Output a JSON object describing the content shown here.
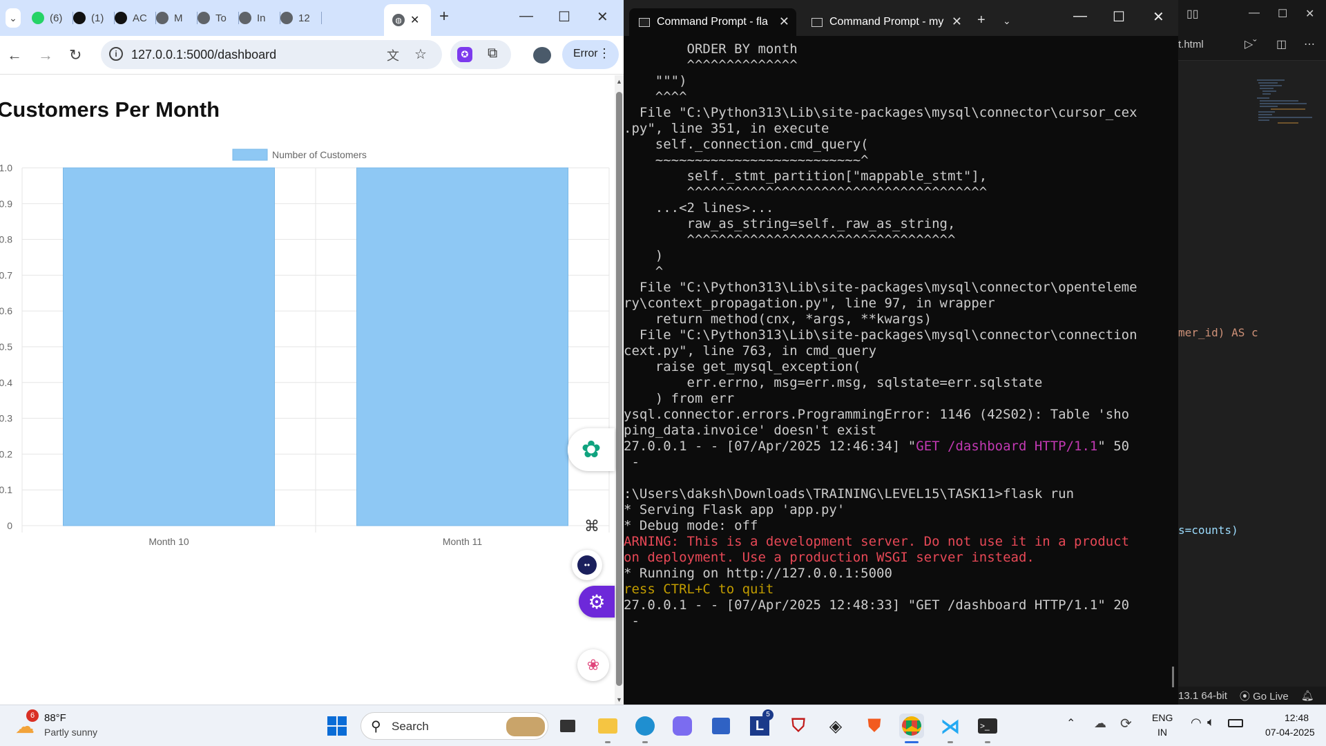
{
  "chrome": {
    "tabs": [
      {
        "label": "(6)",
        "icon": "whatsapp-icon",
        "color": "#25d366"
      },
      {
        "label": "(1)",
        "icon": "notion-icon",
        "color": "#111111"
      },
      {
        "label": "AC",
        "icon": "openai-icon",
        "color": "#111111"
      },
      {
        "label": "M",
        "icon": "globe-icon",
        "color": "#5f6368"
      },
      {
        "label": "To",
        "icon": "globe-icon",
        "color": "#5f6368"
      },
      {
        "label": "In",
        "icon": "globe-icon",
        "color": "#5f6368"
      },
      {
        "label": "12",
        "icon": "globe-icon",
        "color": "#5f6368"
      }
    ],
    "active_tab_close": "✕",
    "new_tab": "+",
    "url": "127.0.0.1:5000/dashboard",
    "error_label": "Error",
    "page_title": "Customers Per Month"
  },
  "chart_data": {
    "type": "bar",
    "title": "Customers Per Month",
    "categories": [
      "Month 10",
      "Month 11"
    ],
    "series": [
      {
        "name": "Number of Customers",
        "values": [
          1,
          1
        ]
      }
    ],
    "ylim": [
      0,
      1
    ],
    "y_ticks": [
      "0",
      "0.1",
      "0.2",
      "0.3",
      "0.4",
      "0.5",
      "0.6",
      "0.7",
      "0.8",
      "0.9",
      "1.0"
    ],
    "grid": true,
    "legend": "top-center",
    "bar_color": "#8ec8f4"
  },
  "terminal": {
    "tabs": [
      {
        "label": "Command Prompt - fla"
      },
      {
        "label": "Command Prompt - my"
      }
    ],
    "lines": [
      {
        "text": "        ORDER BY month",
        "cls": ""
      },
      {
        "text": "        ^^^^^^^^^^^^^^",
        "cls": ""
      },
      {
        "text": "    \"\"\")",
        "cls": ""
      },
      {
        "text": "    ^^^^",
        "cls": ""
      },
      {
        "text": "  File \"C:\\Python313\\Lib\\site-packages\\mysql\\connector\\cursor_cex",
        "cls": ""
      },
      {
        "text": ".py\", line 351, in execute",
        "cls": ""
      },
      {
        "text": "    self._connection.cmd_query(",
        "cls": ""
      },
      {
        "text": "    ~~~~~~~~~~~~~~~~~~~~~~~~~~^",
        "cls": ""
      },
      {
        "text": "        self._stmt_partition[\"mappable_stmt\"],",
        "cls": ""
      },
      {
        "text": "        ^^^^^^^^^^^^^^^^^^^^^^^^^^^^^^^^^^^^^^",
        "cls": ""
      },
      {
        "text": "    ...<2 lines>...",
        "cls": ""
      },
      {
        "text": "        raw_as_string=self._raw_as_string,",
        "cls": ""
      },
      {
        "text": "        ^^^^^^^^^^^^^^^^^^^^^^^^^^^^^^^^^^",
        "cls": ""
      },
      {
        "text": "    )",
        "cls": ""
      },
      {
        "text": "    ^",
        "cls": ""
      },
      {
        "text": "  File \"C:\\Python313\\Lib\\site-packages\\mysql\\connector\\openteleme",
        "cls": ""
      },
      {
        "text": "ry\\context_propagation.py\", line 97, in wrapper",
        "cls": ""
      },
      {
        "text": "    return method(cnx, *args, **kwargs)",
        "cls": ""
      },
      {
        "text": "  File \"C:\\Python313\\Lib\\site-packages\\mysql\\connector\\connection",
        "cls": ""
      },
      {
        "text": "cext.py\", line 763, in cmd_query",
        "cls": ""
      },
      {
        "text": "    raise get_mysql_exception(",
        "cls": ""
      },
      {
        "text": "        err.errno, msg=err.msg, sqlstate=err.sqlstate",
        "cls": ""
      },
      {
        "text": "    ) from err",
        "cls": ""
      },
      {
        "text": "ysql.connector.errors.ProgrammingError: 1146 (42S02): Table 'sho",
        "cls": ""
      },
      {
        "text": "ping_data.invoice' doesn't exist",
        "cls": ""
      }
    ],
    "log_line_1": {
      "prefix": "27.0.0.1 - - [07/Apr/2025 12:46:34] \"",
      "request": "GET /dashboard HTTP/1.1",
      "suffix": "\" 50"
    },
    "lines_after": [
      {
        "text": " -",
        "cls": ""
      },
      {
        "text": "",
        "cls": ""
      },
      {
        "text": ":\\Users\\daksh\\Downloads\\TRAINING\\LEVEL15\\TASK11>flask run",
        "cls": ""
      },
      {
        "text": "* Serving Flask app 'app.py'",
        "cls": ""
      },
      {
        "text": "* Debug mode: off",
        "cls": ""
      },
      {
        "text": "ARNING: This is a development server. Do not use it in a product",
        "cls": "c-red"
      },
      {
        "text": "on deployment. Use a production WSGI server instead.",
        "cls": "c-red"
      },
      {
        "text": "* Running on http://127.0.0.1:5000",
        "cls": ""
      },
      {
        "text": "ress CTRL+C to quit",
        "cls": "c-yel"
      },
      {
        "text": "27.0.0.1 - - [07/Apr/2025 12:48:33] \"GET /dashboard HTTP/1.1\" 20",
        "cls": ""
      },
      {
        "text": " -",
        "cls": ""
      }
    ]
  },
  "vscode": {
    "tab_label": "t.html",
    "code_line_1": "mer_id) AS c",
    "code_line_2": "s=counts)",
    "status_python": "13.1 64-bit",
    "status_golive": "Go Live"
  },
  "taskbar": {
    "weather_temp": "88°F",
    "weather_desc": "Partly sunny",
    "weather_badge": "6",
    "search_label": "Search",
    "lang_top": "ENG",
    "lang_bottom": "IN",
    "time": "12:48",
    "date": "07-04-2025",
    "app_badge": "5"
  }
}
